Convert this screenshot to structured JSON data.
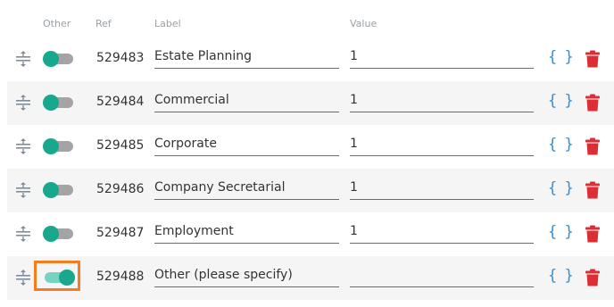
{
  "headers": {
    "other": "Other",
    "ref": "Ref",
    "label": "Label",
    "value": "Value"
  },
  "colors": {
    "toggle_on": "#17a88e",
    "toggle_track_off": "#a4a4a4",
    "braces": "#2f8fd8",
    "delete": "#dc2f35",
    "focus_outline": "#f57c1f"
  },
  "rows": [
    {
      "ref": "529483",
      "label": "Estate Planning",
      "value": "1",
      "other": false
    },
    {
      "ref": "529484",
      "label": "Commercial",
      "value": "1",
      "other": false
    },
    {
      "ref": "529485",
      "label": "Corporate",
      "value": "1",
      "other": false
    },
    {
      "ref": "529486",
      "label": "Company Secretarial",
      "value": "1",
      "other": false
    },
    {
      "ref": "529487",
      "label": "Employment",
      "value": "1",
      "other": false
    },
    {
      "ref": "529488",
      "label": "Other (please specify)",
      "value": "",
      "other": true
    }
  ],
  "icons": {
    "drag": "drag-handle-icon",
    "braces": "braces-icon",
    "delete": "trash-icon"
  },
  "braces_glyph": "{ }"
}
